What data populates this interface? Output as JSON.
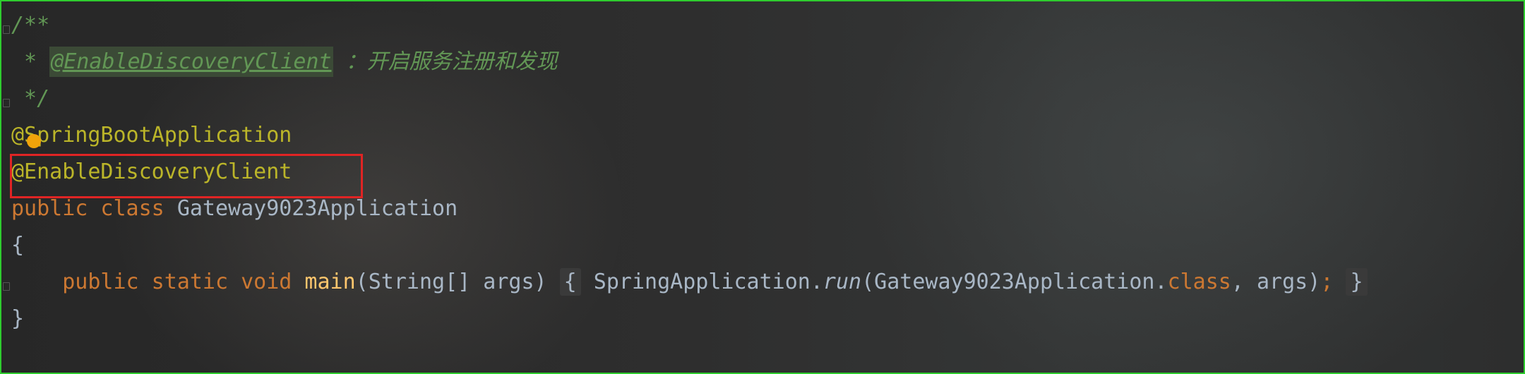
{
  "editor": {
    "lines": [
      {
        "parts": [
          {
            "text": "/**",
            "style": "comment"
          }
        ]
      },
      {
        "parts": [
          {
            "text": " * ",
            "style": "comment"
          },
          {
            "text": "@EnableDiscoveryClient",
            "style": "doctag"
          },
          {
            "text": " ：",
            "style": "comment"
          },
          {
            "text": "开启服务注册和发现",
            "style": "cn"
          }
        ]
      },
      {
        "parts": [
          {
            "text": " */",
            "style": "comment"
          }
        ]
      },
      {
        "parts": [
          {
            "text": "@SpringBootApplication",
            "style": "annot"
          }
        ]
      },
      {
        "parts": [
          {
            "text": "@EnableDiscoveryClient",
            "style": "annot"
          }
        ]
      },
      {
        "parts": [
          {
            "text": "public class ",
            "style": "kw"
          },
          {
            "text": "Gateway9023Application",
            "style": "plain"
          }
        ]
      },
      {
        "parts": [
          {
            "text": "{",
            "style": "plain"
          }
        ]
      },
      {
        "parts": [
          {
            "text": "    public static void ",
            "style": "kw"
          },
          {
            "text": "main",
            "style": "method"
          },
          {
            "text": "(String[] args) ",
            "style": "plain"
          },
          {
            "text": "{",
            "style": "brace"
          },
          {
            "text": " SpringApplication.",
            "style": "plain"
          },
          {
            "text": "run",
            "style": "italic"
          },
          {
            "text": "(Gateway9023Application.",
            "style": "plain"
          },
          {
            "text": "class",
            "style": "kw"
          },
          {
            "text": ", args)",
            "style": "plain"
          },
          {
            "text": "; ",
            "style": "kw"
          },
          {
            "text": "}",
            "style": "brace"
          }
        ]
      },
      {
        "parts": [
          {
            "text": "}",
            "style": "plain"
          }
        ]
      }
    ]
  },
  "highlight": {
    "label": "@EnableDiscoveryClient",
    "color": "#e02424"
  },
  "colors": {
    "comment": "#629755",
    "annotation": "#bbb529",
    "keyword": "#cc7832",
    "text": "#a9b7c6",
    "method": "#ffc66d",
    "frame": "#2ecc2e"
  },
  "icons": {
    "bulb": "lightbulb-icon"
  }
}
